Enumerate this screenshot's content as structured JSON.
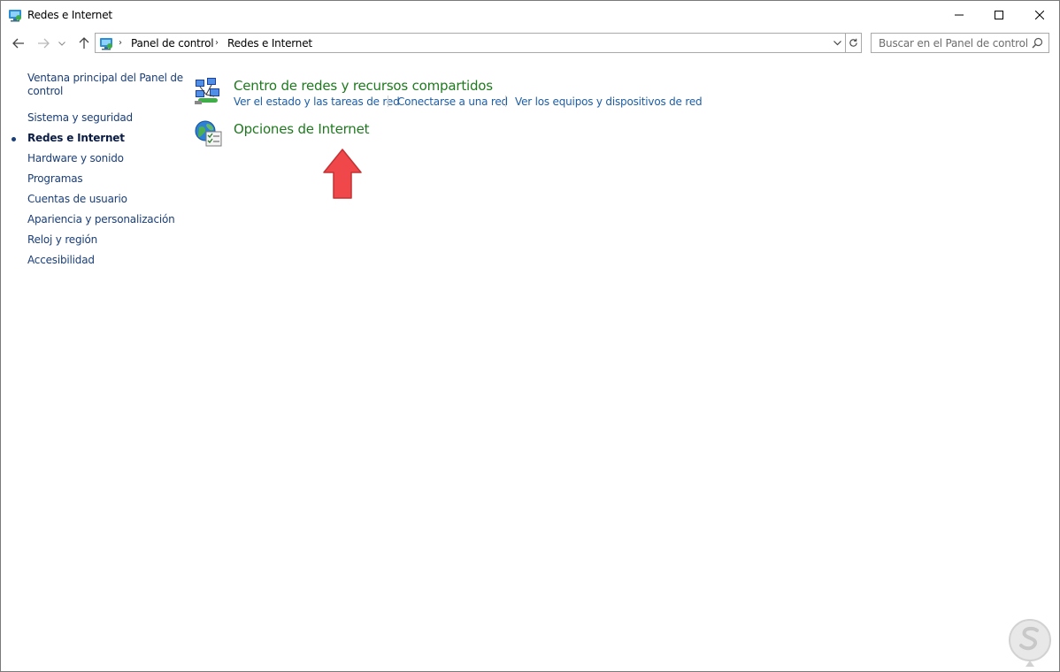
{
  "window": {
    "title": "Redes e Internet"
  },
  "address": {
    "breadcrumbs": [
      "Panel de control",
      "Redes e Internet"
    ]
  },
  "search": {
    "placeholder": "Buscar en el Panel de control"
  },
  "sidebar": {
    "items": [
      {
        "label": "Ventana principal del Panel de",
        "label2": "control",
        "active": false
      },
      {
        "label": "Sistema y seguridad",
        "active": false
      },
      {
        "label": "Redes e Internet",
        "active": true
      },
      {
        "label": "Hardware y sonido",
        "active": false
      },
      {
        "label": "Programas",
        "active": false
      },
      {
        "label": "Cuentas de usuario",
        "active": false
      },
      {
        "label": "Apariencia y personalización",
        "active": false
      },
      {
        "label": "Reloj y región",
        "active": false
      },
      {
        "label": "Accesibilidad",
        "active": false
      }
    ]
  },
  "main": {
    "categories": [
      {
        "title": "Centro de redes y recursos compartidos",
        "icon": "network-center-icon",
        "tasks": [
          "Ver el estado y las tareas de red",
          "Conectarse a una red",
          "Ver los equipos y dispositivos de red"
        ]
      },
      {
        "title": "Opciones de Internet",
        "icon": "internet-options-icon",
        "tasks": []
      }
    ]
  },
  "colors": {
    "category_title": "#1f7a1f",
    "task_link": "#1d5ea6",
    "sidebar_link": "#1a3e78",
    "annotation_arrow": "#f0474a"
  }
}
